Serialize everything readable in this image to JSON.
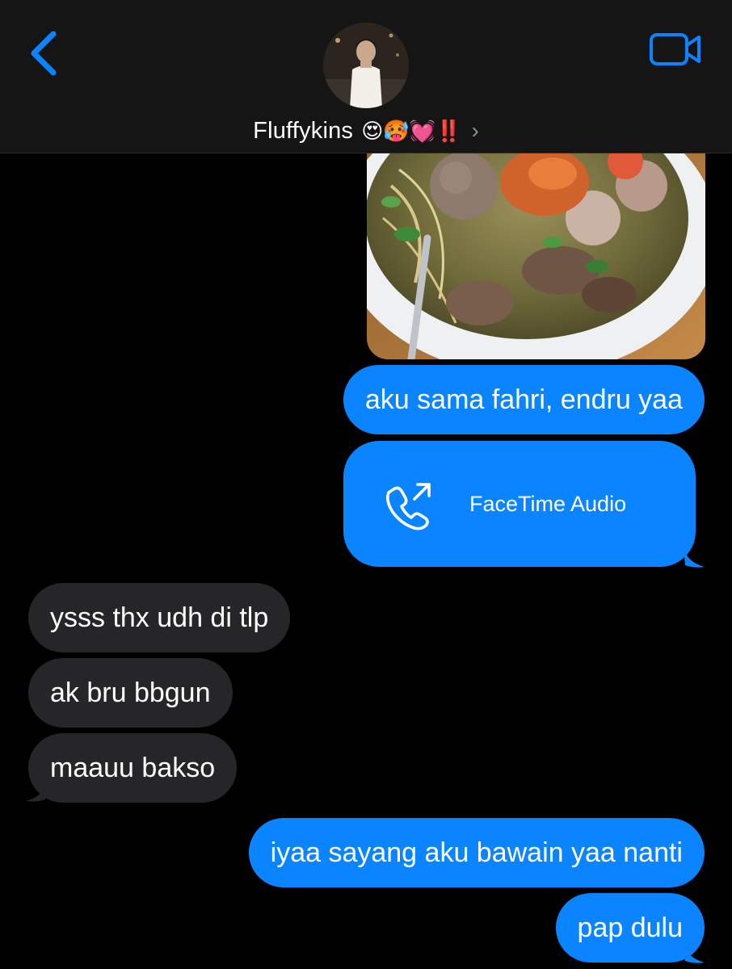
{
  "header": {
    "contact_name": "Fluffykins",
    "contact_emoji": "😍🥵💓‼️",
    "back_icon": "chevron-left-icon",
    "video_icon": "video-camera-icon",
    "accent_color": "#0a84ff"
  },
  "messages": [
    {
      "type": "image",
      "direction": "outgoing",
      "description_icon": "food-photo"
    },
    {
      "type": "text",
      "direction": "outgoing",
      "text": "aku sama fahri, endru yaa"
    },
    {
      "type": "call",
      "direction": "outgoing",
      "label": "FaceTime Audio",
      "icon": "outgoing-call-icon"
    },
    {
      "type": "text",
      "direction": "incoming",
      "text": "ysss thx udh di tlp"
    },
    {
      "type": "text",
      "direction": "incoming",
      "text": "ak bru bbgun"
    },
    {
      "type": "text",
      "direction": "incoming",
      "text": "maauu bakso"
    },
    {
      "type": "text",
      "direction": "outgoing",
      "text": "iyaa sayang aku bawain yaa nanti"
    },
    {
      "type": "text",
      "direction": "outgoing",
      "text": "pap dulu"
    }
  ],
  "colors": {
    "outgoing_bubble": "#0a84ff",
    "incoming_bubble": "#262628",
    "background": "#000000",
    "header": "#151515"
  }
}
